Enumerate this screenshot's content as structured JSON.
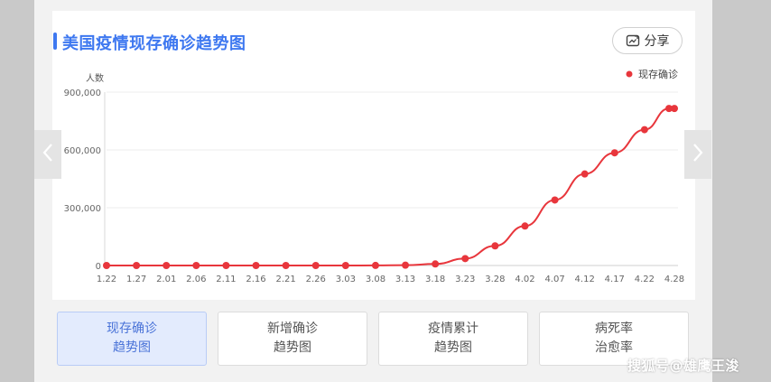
{
  "header": {
    "title": "美国疫情现存确诊趋势图",
    "share_label": "分享",
    "share_icon": "share-icon"
  },
  "nav": {
    "prev_icon": "chevron-left-icon",
    "next_icon": "chevron-right-icon"
  },
  "tabs": [
    {
      "line1": "现存确诊",
      "line2": "趋势图",
      "active": true
    },
    {
      "line1": "新增确诊",
      "line2": "趋势图",
      "active": false
    },
    {
      "line1": "疫情累计",
      "line2": "趋势图",
      "active": false
    },
    {
      "line1": "病死率",
      "line2": "治愈率",
      "active": false
    }
  ],
  "watermark": "搜狐号@雄鹰王浚",
  "colors": {
    "accent": "#3e78f0",
    "series": "#e8363c"
  },
  "chart_data": {
    "type": "line",
    "title": "",
    "xlabel": "",
    "ylabel": "人数",
    "ylim": [
      0,
      900000
    ],
    "yticks": [
      0,
      300000,
      600000,
      900000
    ],
    "ytick_labels": [
      "0",
      "300,000",
      "600,000",
      "900,000"
    ],
    "x_tick_labels": [
      "1.22",
      "1.27",
      "2.01",
      "2.06",
      "2.11",
      "2.16",
      "2.21",
      "2.26",
      "3.03",
      "3.08",
      "3.13",
      "3.18",
      "3.23",
      "3.28",
      "4.02",
      "4.07",
      "4.12",
      "4.17",
      "4.22",
      "4.28"
    ],
    "grid": true,
    "legend": "top-right",
    "series": [
      {
        "name": "现存确诊",
        "color": "#e8363c",
        "x": [
          "1.22",
          "1.27",
          "2.01",
          "2.06",
          "2.11",
          "2.16",
          "2.21",
          "2.26",
          "3.03",
          "3.08",
          "3.13",
          "3.18",
          "3.23",
          "3.28",
          "4.02",
          "4.07",
          "4.12",
          "4.17",
          "4.22",
          "4.27",
          "4.28"
        ],
        "values": [
          0,
          0,
          0,
          0,
          0,
          0,
          0,
          0,
          0,
          300,
          1800,
          8000,
          36000,
          102000,
          205000,
          340000,
          475000,
          585000,
          705000,
          815000,
          815000
        ]
      }
    ]
  }
}
